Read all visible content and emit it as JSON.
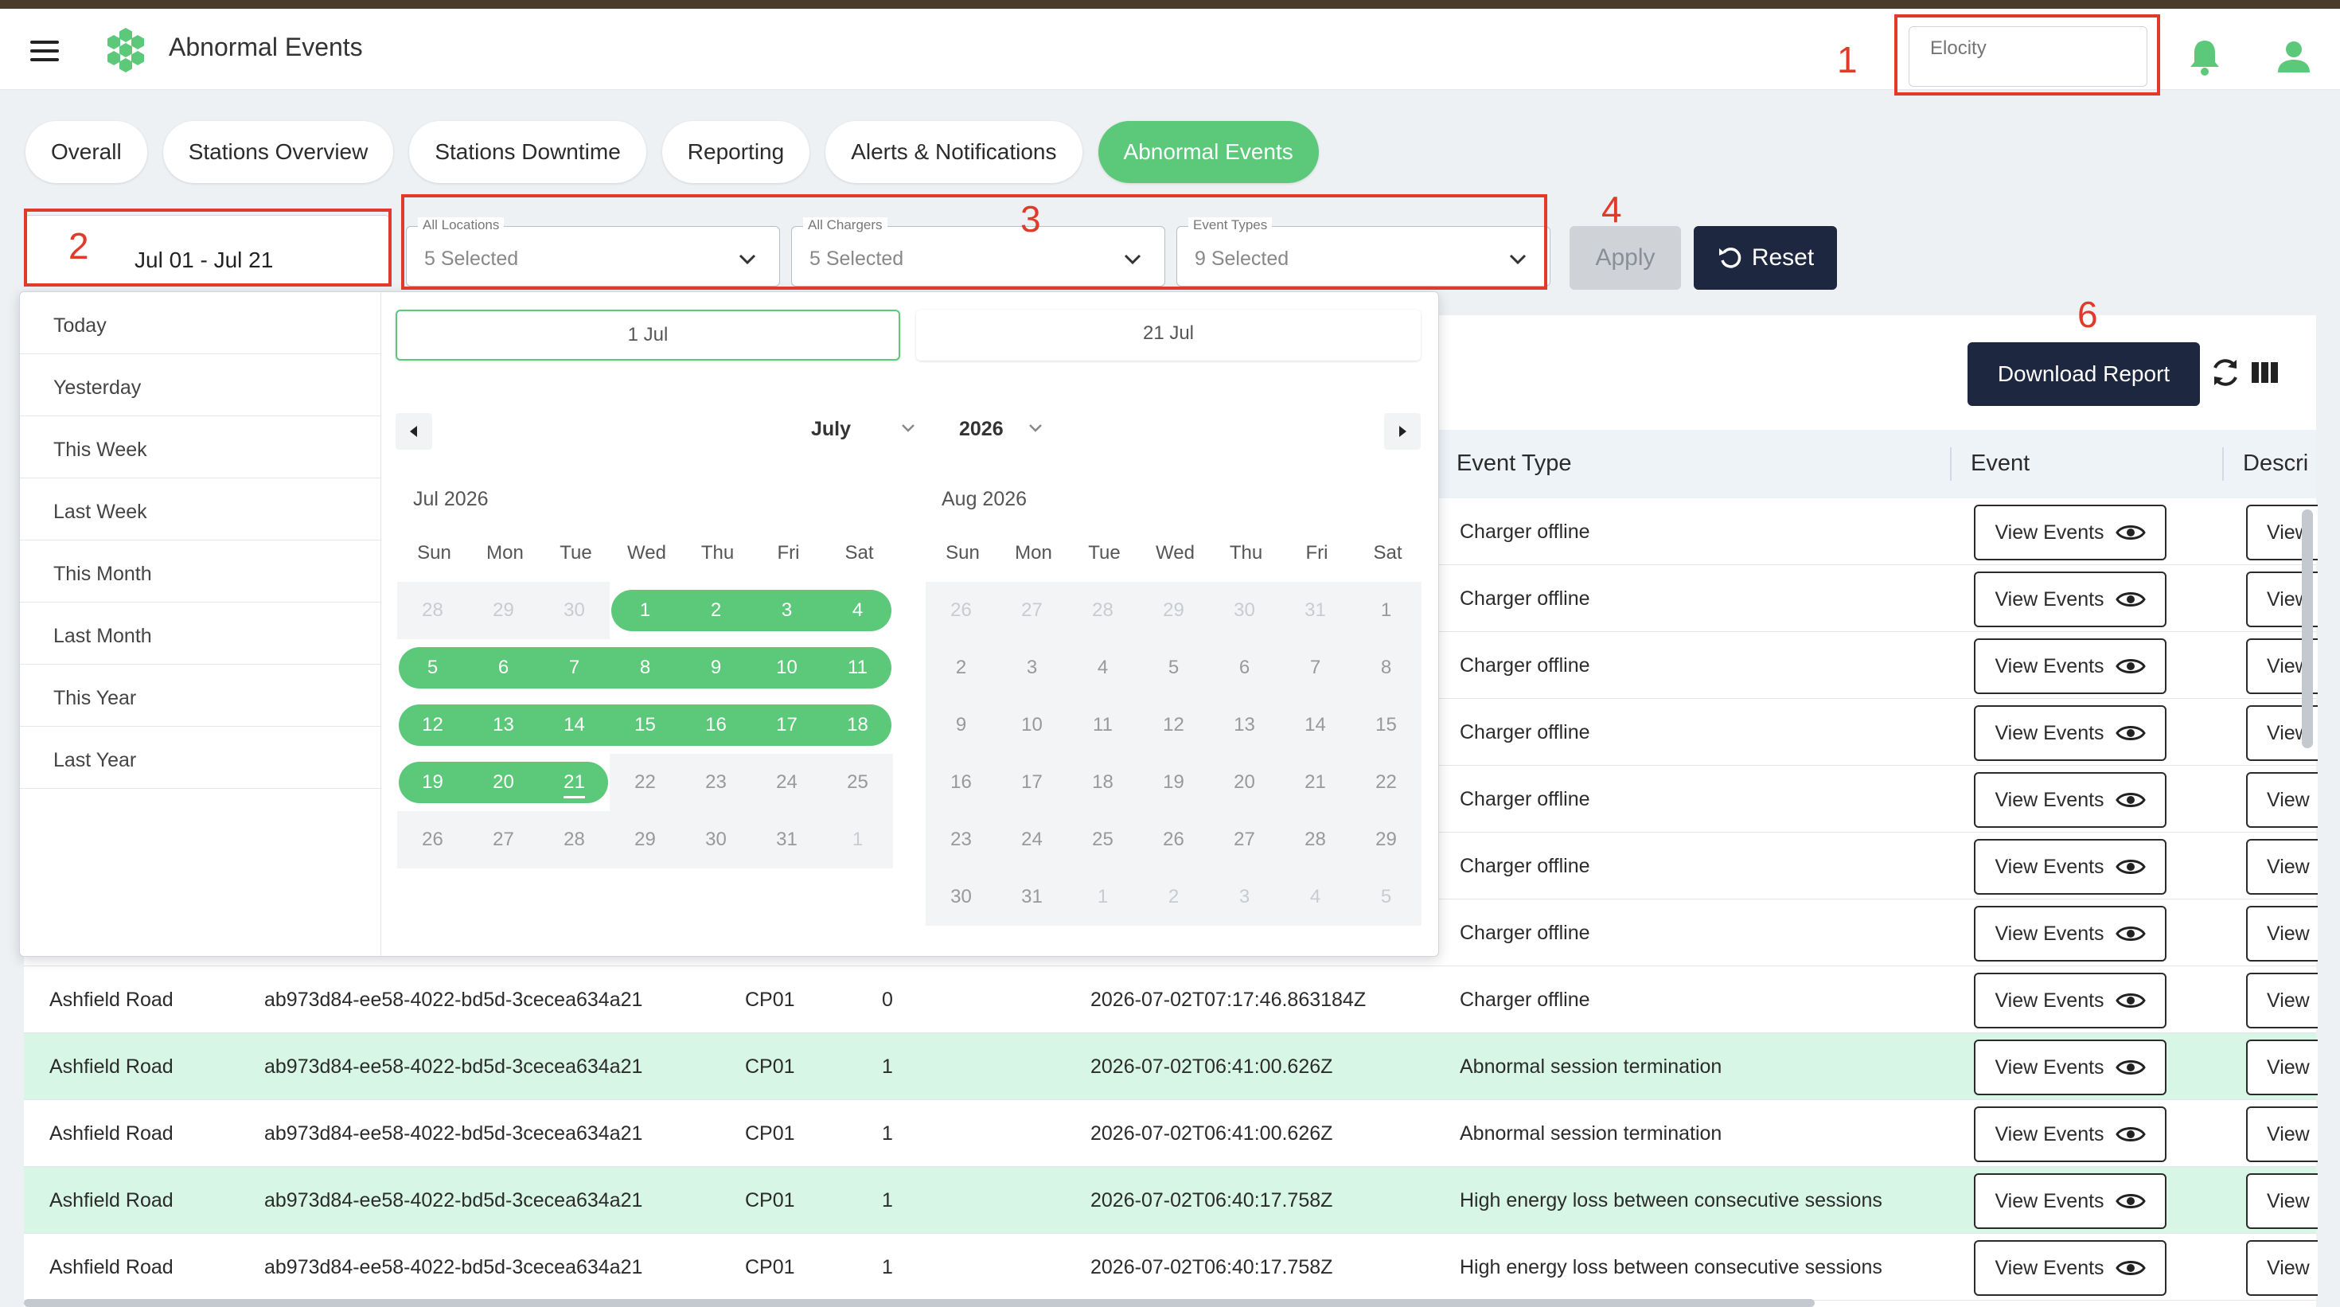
{
  "app": {
    "title": "Abnormal Events"
  },
  "header": {
    "org_placeholder": "Elocity"
  },
  "tabs": [
    {
      "label": "Overall",
      "active": false
    },
    {
      "label": "Stations Overview",
      "active": false
    },
    {
      "label": "Stations Downtime",
      "active": false
    },
    {
      "label": "Reporting",
      "active": false
    },
    {
      "label": "Alerts & Notifications",
      "active": false
    },
    {
      "label": "Abnormal Events",
      "active": true
    }
  ],
  "filters": {
    "date_range": "Jul 01 - Jul 21",
    "locations": {
      "label": "All Locations",
      "value": "5 Selected"
    },
    "chargers": {
      "label": "All Chargers",
      "value": "5 Selected"
    },
    "event_types": {
      "label": "Event Types",
      "value": "9 Selected"
    },
    "apply_label": "Apply",
    "reset_label": "Reset"
  },
  "picker": {
    "presets": [
      "Today",
      "Yesterday",
      "This Week",
      "Last Week",
      "This Month",
      "Last Month",
      "This Year",
      "Last Year"
    ],
    "start": "1 Jul",
    "end": "21 Jul",
    "month": "July",
    "year": "2026",
    "weekdays": [
      "Sun",
      "Mon",
      "Tue",
      "Wed",
      "Thu",
      "Fri",
      "Sat"
    ],
    "left_title": "Jul 2026",
    "right_title": "Aug 2026",
    "left_weeks": [
      [
        "28",
        "29",
        "30",
        "1",
        "2",
        "3",
        "4"
      ],
      [
        "5",
        "6",
        "7",
        "8",
        "9",
        "10",
        "11"
      ],
      [
        "12",
        "13",
        "14",
        "15",
        "16",
        "17",
        "18"
      ],
      [
        "19",
        "20",
        "21",
        "22",
        "23",
        "24",
        "25"
      ],
      [
        "26",
        "27",
        "28",
        "29",
        "30",
        "31",
        "1"
      ]
    ],
    "right_weeks": [
      [
        "26",
        "27",
        "28",
        "29",
        "30",
        "31",
        "1"
      ],
      [
        "2",
        "3",
        "4",
        "5",
        "6",
        "7",
        "8"
      ],
      [
        "9",
        "10",
        "11",
        "12",
        "13",
        "14",
        "15"
      ],
      [
        "16",
        "17",
        "18",
        "19",
        "20",
        "21",
        "22"
      ],
      [
        "23",
        "24",
        "25",
        "26",
        "27",
        "28",
        "29"
      ],
      [
        "30",
        "31",
        "1",
        "2",
        "3",
        "4",
        "5"
      ]
    ]
  },
  "toolbar": {
    "download_label": "Download Report"
  },
  "table": {
    "headers": {
      "event_type": "Event Type",
      "event": "Event",
      "description": "Descri"
    },
    "view_label": "View Events",
    "view_label_short": "View",
    "rows": [
      {
        "location": "",
        "id": "",
        "charger": "",
        "connector": "",
        "time": "",
        "event_type": "Charger offline"
      },
      {
        "location": "",
        "id": "",
        "charger": "",
        "connector": "",
        "time": "",
        "event_type": "Charger offline"
      },
      {
        "location": "",
        "id": "",
        "charger": "",
        "connector": "",
        "time": "",
        "event_type": "Charger offline"
      },
      {
        "location": "",
        "id": "",
        "charger": "",
        "connector": "",
        "time": "",
        "event_type": "Charger offline"
      },
      {
        "location": "",
        "id": "",
        "charger": "",
        "connector": "",
        "time": "",
        "event_type": "Charger offline"
      },
      {
        "location": "",
        "id": "",
        "charger": "",
        "connector": "",
        "time": "",
        "event_type": "Charger offline"
      },
      {
        "location": "",
        "id": "",
        "charger": "",
        "connector": "",
        "time": "",
        "event_type": "Charger offline"
      },
      {
        "location": "Ashfield Road",
        "id": "ab973d84-ee58-4022-bd5d-3cecea634a21",
        "charger": "CP01",
        "connector": "0",
        "time": "2026-07-02T07:17:46.863184Z",
        "event_type": "Charger offline"
      },
      {
        "location": "Ashfield Road",
        "id": "ab973d84-ee58-4022-bd5d-3cecea634a21",
        "charger": "CP01",
        "connector": "1",
        "time": "2026-07-02T06:41:00.626Z",
        "event_type": "Abnormal session termination"
      },
      {
        "location": "Ashfield Road",
        "id": "ab973d84-ee58-4022-bd5d-3cecea634a21",
        "charger": "CP01",
        "connector": "1",
        "time": "2026-07-02T06:41:00.626Z",
        "event_type": "Abnormal session termination"
      },
      {
        "location": "Ashfield Road",
        "id": "ab973d84-ee58-4022-bd5d-3cecea634a21",
        "charger": "CP01",
        "connector": "1",
        "time": "2026-07-02T06:40:17.758Z",
        "event_type": "High energy loss between consecutive sessions"
      },
      {
        "location": "Ashfield Road",
        "id": "ab973d84-ee58-4022-bd5d-3cecea634a21",
        "charger": "CP01",
        "connector": "1",
        "time": "2026-07-02T06:40:17.758Z",
        "event_type": "High energy loss between consecutive sessions"
      }
    ]
  },
  "annotations": [
    "1",
    "2",
    "3",
    "4",
    "6"
  ],
  "colors": {
    "accent": "#5cc97a",
    "dark": "#1e2740",
    "annotation": "#e03a2b",
    "row_alt": "#d8f6e6"
  }
}
